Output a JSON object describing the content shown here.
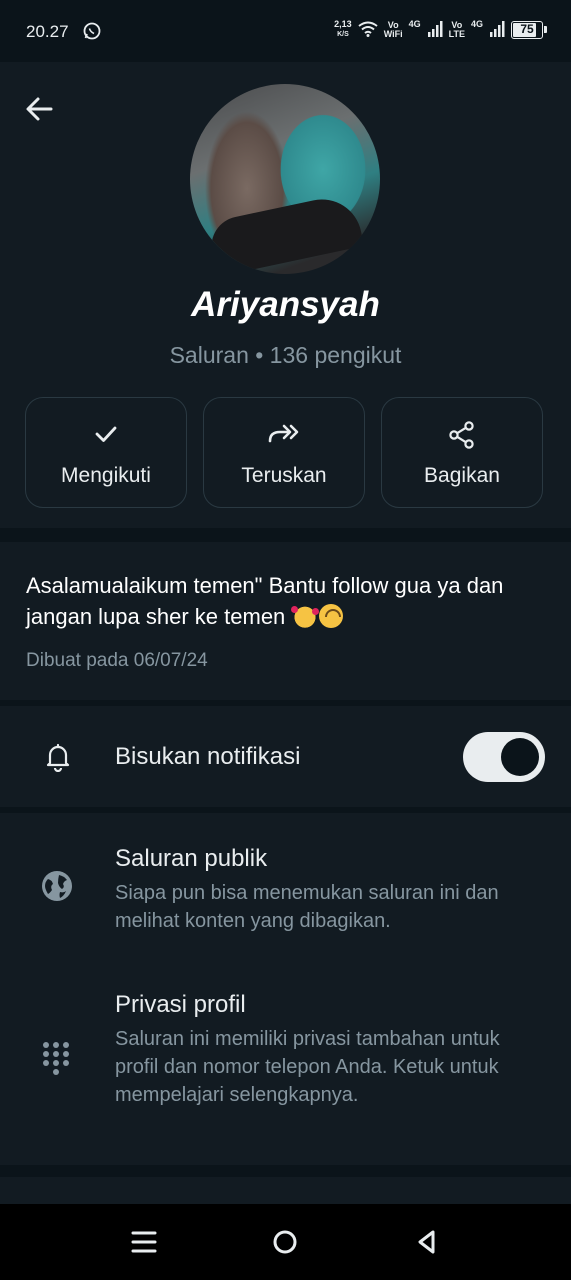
{
  "status_bar": {
    "time": "20.27",
    "speed_value": "2,13",
    "speed_unit": "K/S",
    "vowifi_top": "Vo",
    "vowifi_bottom": "WiFi",
    "net1": "4G",
    "volte_top": "Vo",
    "volte_bottom": "LTE",
    "net2": "4G",
    "battery": "75"
  },
  "channel": {
    "name": "Ariyansyah",
    "meta": "Saluran • 136 pengikut"
  },
  "actions": [
    {
      "label": "Mengikuti",
      "icon": "check-icon"
    },
    {
      "label": "Teruskan",
      "icon": "forward-icon"
    },
    {
      "label": "Bagikan",
      "icon": "share-icon"
    }
  ],
  "description": {
    "text": "Asalamualaikum temen\" Bantu follow gua ya dan jangan lupa sher ke temen",
    "emojis": [
      "smiling-face-with-hearts",
      "upside-down-face"
    ],
    "created": "Dibuat pada 06/07/24"
  },
  "mute": {
    "label": "Bisukan notifikasi",
    "enabled": true
  },
  "info": [
    {
      "icon": "globe-icon",
      "title": "Saluran publik",
      "subtitle": "Siapa pun bisa menemukan saluran ini dan melihat konten yang dibagikan."
    },
    {
      "icon": "dialpad-icon",
      "title": "Privasi profil",
      "subtitle": "Saluran ini memiliki privasi tambahan untuk profil dan nomor telepon Anda. Ketuk untuk mempelajari selengkapnya."
    }
  ],
  "colors": {
    "background": "#0b141a",
    "panel": "#121b22",
    "text_primary": "#e9edef",
    "text_secondary": "#8696a0",
    "border": "#2a3942"
  }
}
